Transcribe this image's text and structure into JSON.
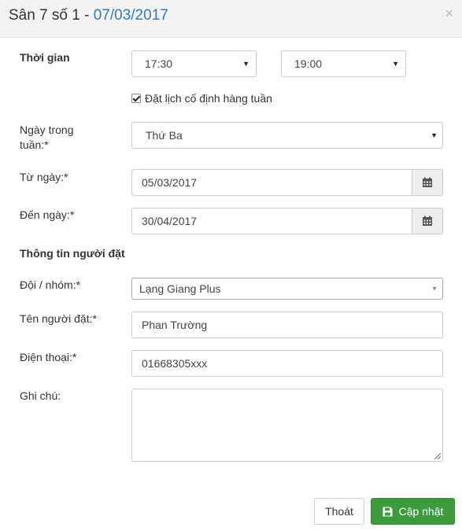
{
  "header": {
    "title": "Sân 7 số 1 - ",
    "date": "07/03/2017",
    "close_symbol": "×"
  },
  "form": {
    "time_label": "Thời gian",
    "start_time": "17:30",
    "end_time": "19:00",
    "recurring": {
      "label": "Đặt lịch cố định hàng tuần",
      "checked": true
    },
    "weekday": {
      "label_line1": "Ngày trong",
      "label_line2": "tuần:*",
      "value": "Thứ Ba"
    },
    "from_date": {
      "label": "Từ ngày:*",
      "value": "05/03/2017"
    },
    "to_date": {
      "label": "Đến ngày:*",
      "value": "30/04/2017"
    },
    "booker_section_title": "Thông tin người đặt",
    "team": {
      "label": "Đội / nhóm:*",
      "value": "Lạng Giang Plus"
    },
    "booker_name": {
      "label": "Tên người đặt:*",
      "value": "Phan Trường"
    },
    "phone": {
      "label": "Điện thoại:*",
      "value": "01668305xxx"
    },
    "note": {
      "label": "Ghi chú:",
      "value": ""
    }
  },
  "footer": {
    "cancel_label": "Thoát",
    "submit_label": "Cập nhật"
  },
  "icons": {
    "calendar": "calendar-icon",
    "save": "floppy-disk-icon",
    "caret": "caret-down-icon",
    "close": "close-icon"
  },
  "colors": {
    "title_date": "#337ab7",
    "submit_button": "#3c9c3c",
    "header_bg": "#f3f3f3"
  }
}
